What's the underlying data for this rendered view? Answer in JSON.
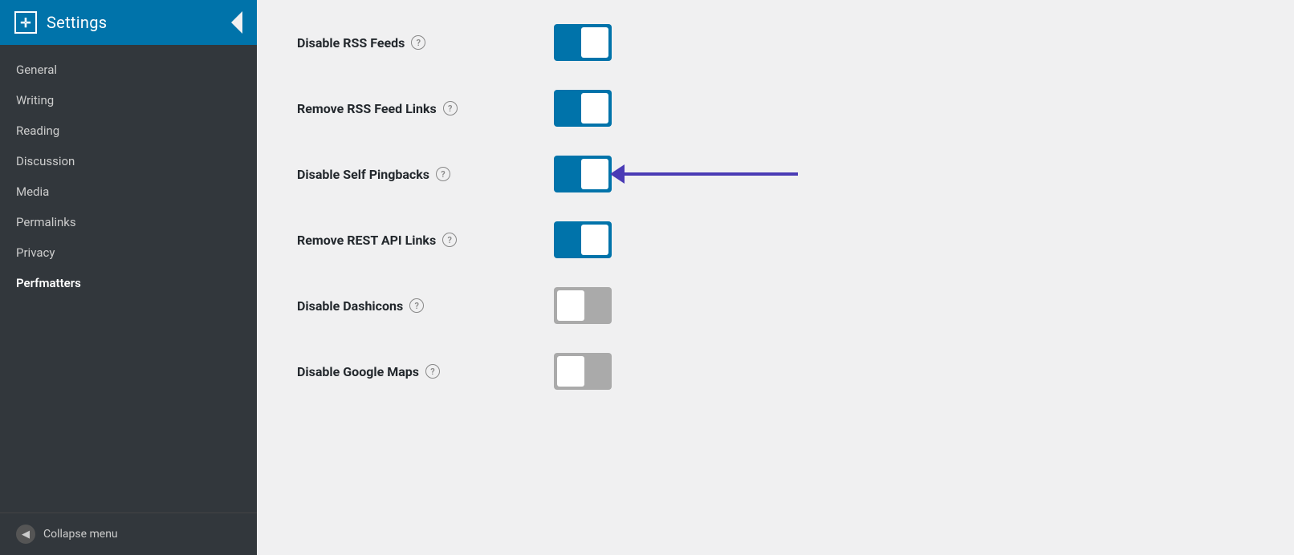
{
  "sidebar": {
    "header": {
      "title": "Settings",
      "icon_symbol": "✛"
    },
    "nav_items": [
      {
        "label": "General",
        "active": false
      },
      {
        "label": "Writing",
        "active": false
      },
      {
        "label": "Reading",
        "active": false
      },
      {
        "label": "Discussion",
        "active": false
      },
      {
        "label": "Media",
        "active": false
      },
      {
        "label": "Permalinks",
        "active": false
      },
      {
        "label": "Privacy",
        "active": false
      },
      {
        "label": "Perfmatters",
        "active": true
      }
    ],
    "collapse_label": "Collapse menu"
  },
  "main": {
    "settings": [
      {
        "id": "disable-rss-feeds",
        "label": "Disable RSS Feeds",
        "state": "on"
      },
      {
        "id": "remove-rss-feed-links",
        "label": "Remove RSS Feed Links",
        "state": "on"
      },
      {
        "id": "disable-self-pingbacks",
        "label": "Disable Self Pingbacks",
        "state": "on",
        "arrow": true
      },
      {
        "id": "remove-rest-api-links",
        "label": "Remove REST API Links",
        "state": "on"
      },
      {
        "id": "disable-dashicons",
        "label": "Disable Dashicons",
        "state": "off"
      },
      {
        "id": "disable-google-maps",
        "label": "Disable Google Maps",
        "state": "off"
      }
    ],
    "help_label": "?"
  },
  "colors": {
    "toggle_on": "#0073aa",
    "toggle_off": "#aaaaaa",
    "arrow": "#4a3bb5",
    "sidebar_bg": "#32373c",
    "header_bg": "#0073aa"
  }
}
